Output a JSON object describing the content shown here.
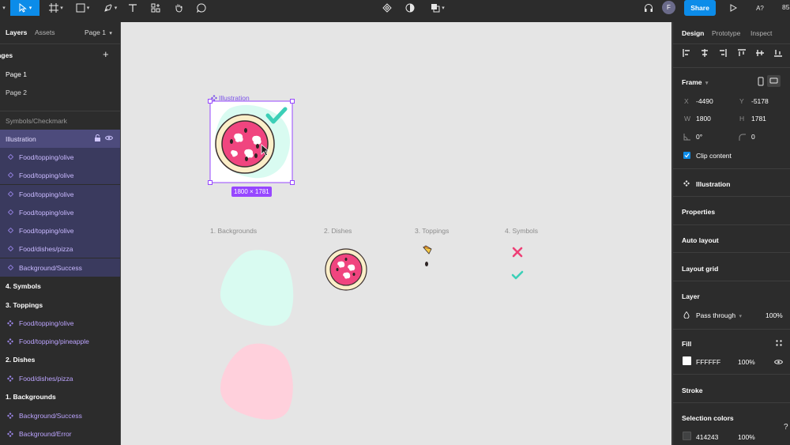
{
  "toolbar": {
    "title_center_icons": [
      "component-icon",
      "contrast-icon",
      "boolean-icon"
    ],
    "avatar_initial": "F",
    "share_label": "Share",
    "a11y_label": "A?",
    "zoom": "85"
  },
  "left_panel": {
    "tab_layers": "Layers",
    "tab_assets": "Assets",
    "page_selector": "Page 1",
    "pages_header": "Pages",
    "pages": [
      "Page 1",
      "Page 2"
    ],
    "layers": [
      {
        "label": "Symbols/Checkmark",
        "kind": "section-dim"
      },
      {
        "label": "Illustration",
        "kind": "selected-frame"
      },
      {
        "label": "Food/topping/olive",
        "kind": "selected-child"
      },
      {
        "label": "Food/topping/olive",
        "kind": "selected-child"
      },
      {
        "label": "Food/topping/olive",
        "kind": "selected-child"
      },
      {
        "label": "Food/topping/olive",
        "kind": "selected-child"
      },
      {
        "label": "Food/topping/olive",
        "kind": "selected-child"
      },
      {
        "label": "Food/dishes/pizza",
        "kind": "selected-child"
      },
      {
        "label": "Background/Success",
        "kind": "selected-child"
      },
      {
        "label": "4. Symbols",
        "kind": "section"
      },
      {
        "label": "3. Toppings",
        "kind": "section"
      },
      {
        "label": "Food/topping/olive",
        "kind": "component"
      },
      {
        "label": "Food/topping/pineapple",
        "kind": "component"
      },
      {
        "label": "2. Dishes",
        "kind": "section"
      },
      {
        "label": "Food/dishes/pizza",
        "kind": "component"
      },
      {
        "label": "1. Backgrounds",
        "kind": "section"
      },
      {
        "label": "Background/Success",
        "kind": "component"
      },
      {
        "label": "Background/Error",
        "kind": "component"
      }
    ]
  },
  "canvas": {
    "frame_label": "Illustration",
    "size_badge": "1800 × 1781",
    "section_labels": [
      "1. Backgrounds",
      "2. Dishes",
      "3. Toppings",
      "4. Symbols"
    ]
  },
  "right_panel": {
    "tabs": [
      "Design",
      "Prototype",
      "Inspect"
    ],
    "frame_label": "Frame",
    "x_label": "X",
    "x_value": "-4490",
    "y_label": "Y",
    "y_value": "-5178",
    "w_label": "W",
    "w_value": "1800",
    "h_label": "H",
    "h_value": "1781",
    "rotation_value": "0°",
    "radius_value": "0",
    "clip_content": "Clip content",
    "component_name": "Illustration",
    "properties": "Properties",
    "auto_layout": "Auto layout",
    "layout_grid": "Layout grid",
    "layer_header": "Layer",
    "blend_mode": "Pass through",
    "layer_opacity": "100%",
    "fill_header": "Fill",
    "fill_hex": "FFFFFF",
    "fill_opacity": "100%",
    "stroke_header": "Stroke",
    "selection_colors": "Selection colors",
    "sel_color_hex": "414243",
    "sel_color_opacity": "100%",
    "help": "?"
  },
  "colors": {
    "accent": "#0c8ce9",
    "selection_purple": "#9747ff",
    "canvas_bg": "#e5e5e5",
    "mint_blob": "#d9fbf1",
    "pink_blob": "#ffd0dc",
    "pizza_pink": "#f0457f",
    "check_teal": "#3ccfb7",
    "cross_pink": "#ee3f76"
  }
}
